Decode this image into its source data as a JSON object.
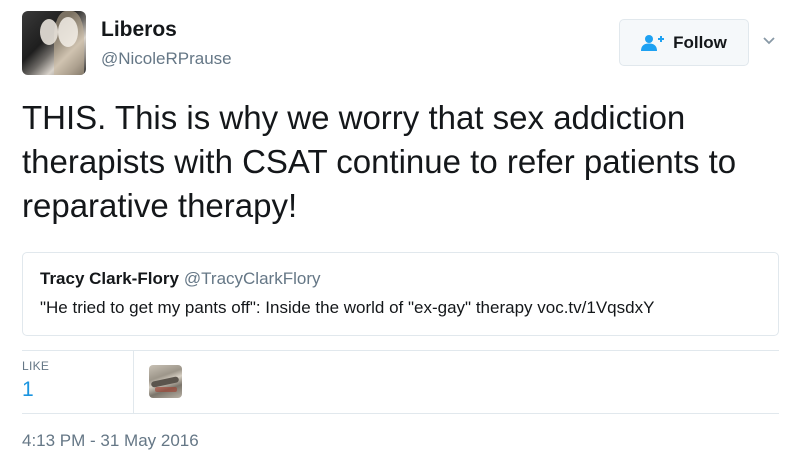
{
  "author": {
    "name": "Liberos",
    "handle": "@NicoleRPrause"
  },
  "follow_button": {
    "label": "Follow"
  },
  "tweet": {
    "text": "THIS. This is why we worry that sex addiction therapists with CSAT continue to refer patients to reparative therapy!"
  },
  "quoted_tweet": {
    "name": "Tracy Clark-Flory",
    "handle": "@TracyClarkFlory",
    "text": "\"He tried to get my pants off\": Inside the world of \"ex-gay\" therapy voc.tv/1VqsdxY"
  },
  "stats": {
    "likes_label": "LIKE",
    "likes_count": "1"
  },
  "timestamp": "4:13 PM - 31 May 2016",
  "colors": {
    "accent": "#1b95e0",
    "secondary_text": "#657786",
    "border": "#e1e8ed"
  },
  "icons": {
    "follow": "person-plus-icon",
    "more": "chevron-down-icon"
  }
}
